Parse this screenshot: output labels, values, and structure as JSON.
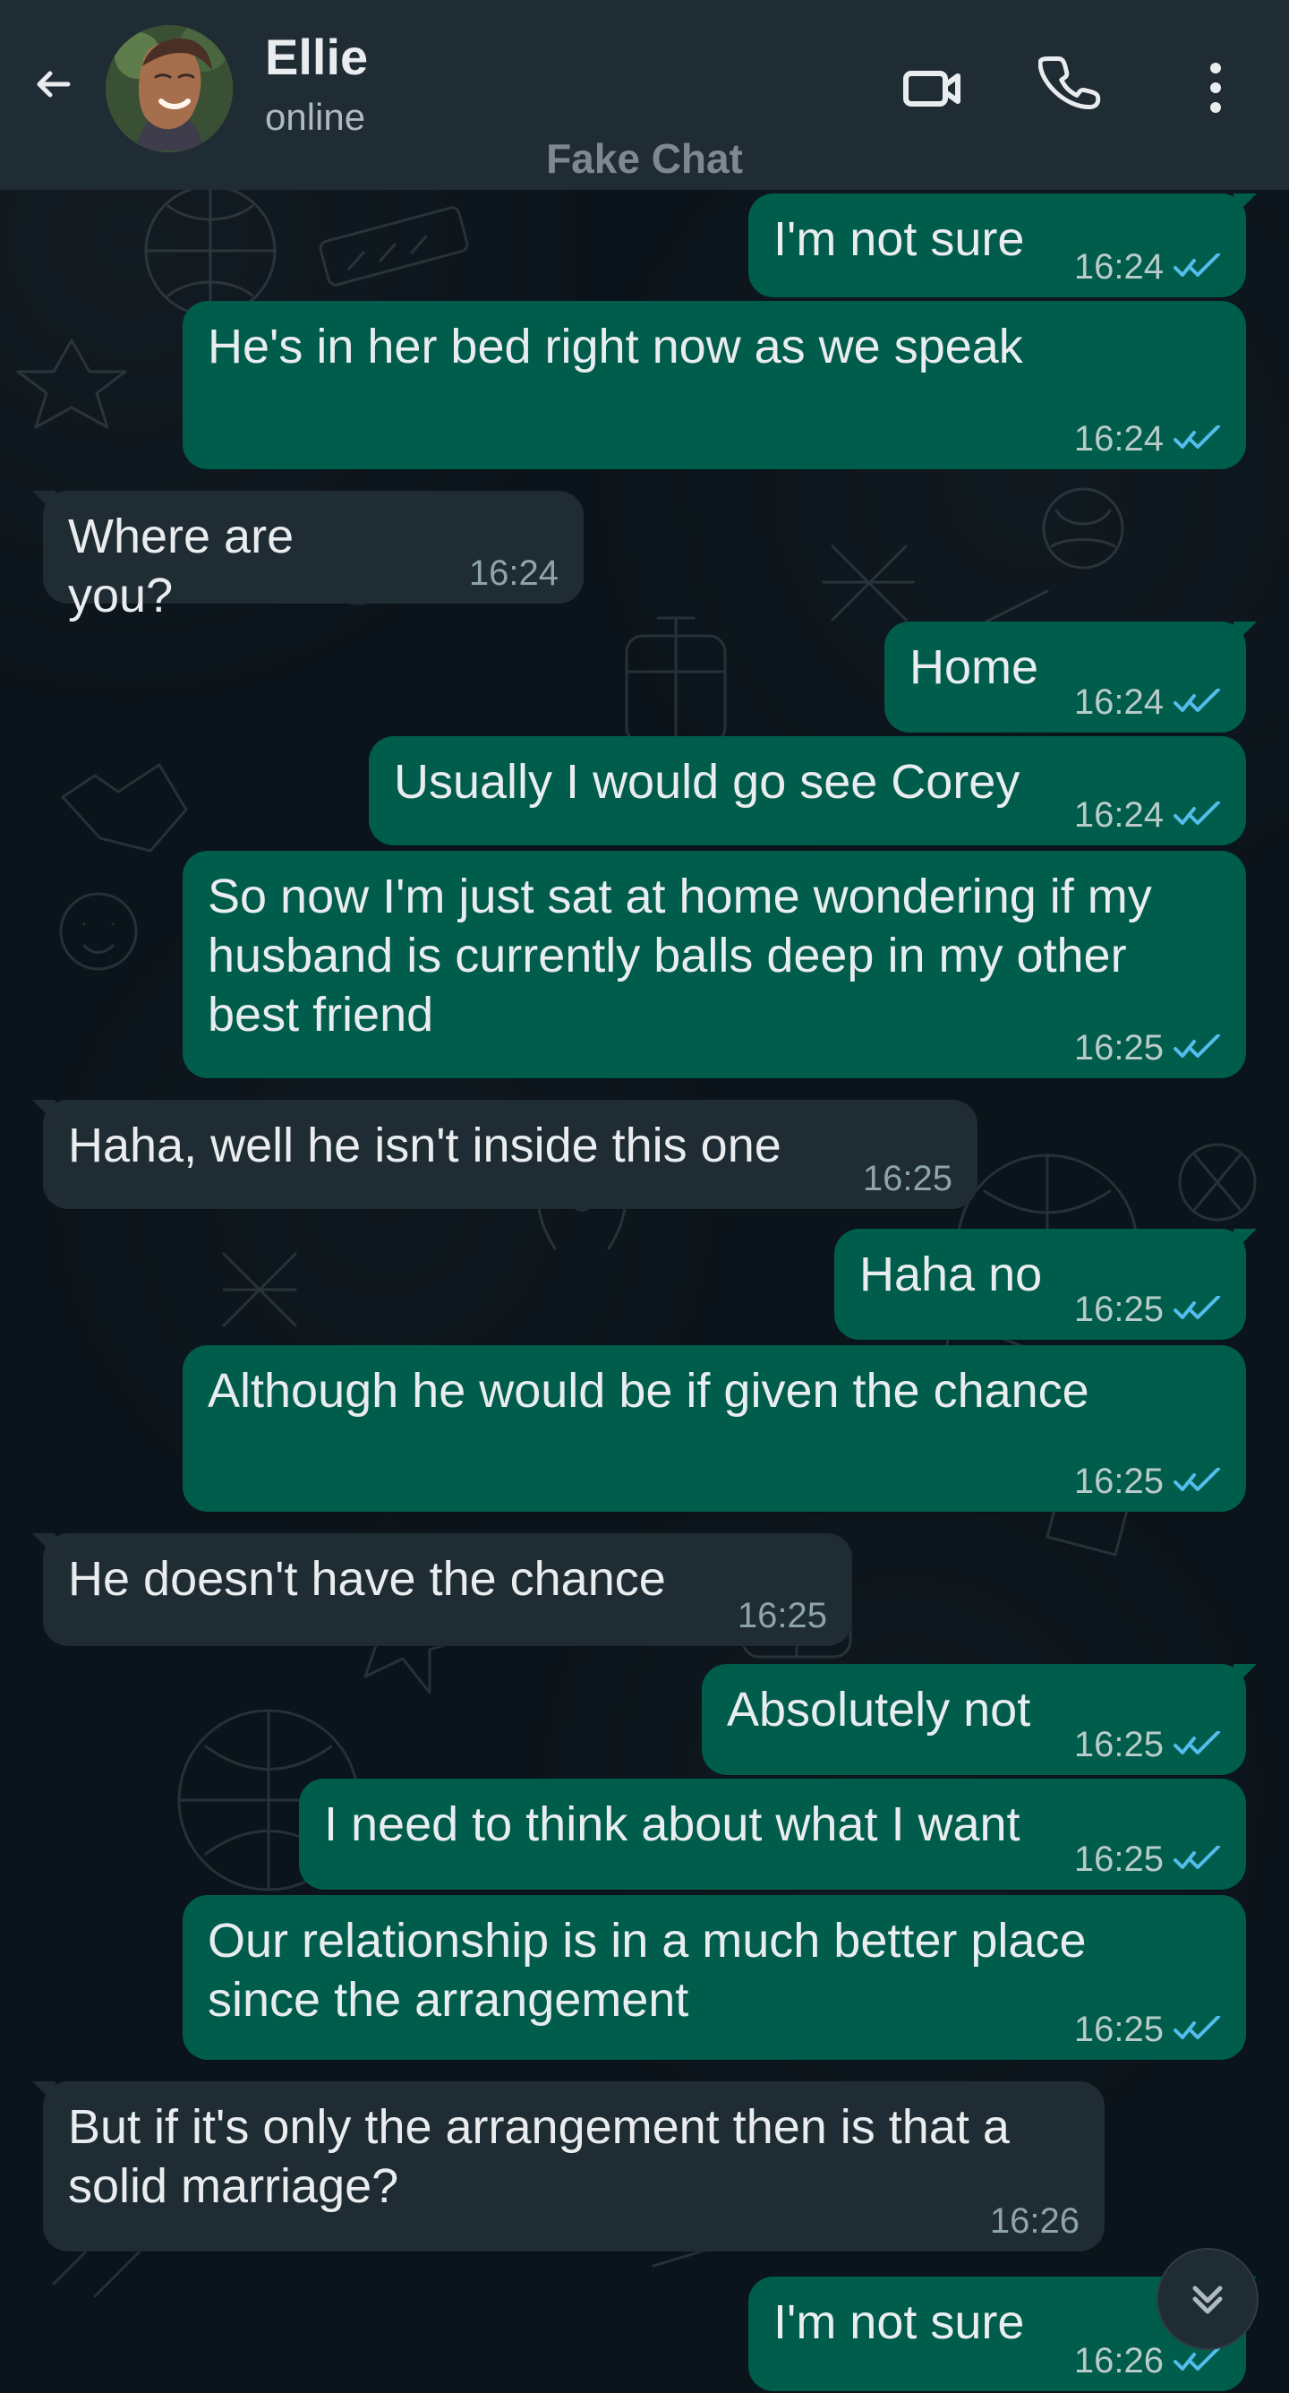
{
  "header": {
    "contact_name": "Ellie",
    "status": "online",
    "watermark": "Fake Chat"
  },
  "icons": {
    "back": "arrow-back-icon",
    "video": "video-call-icon",
    "phone": "phone-icon",
    "more": "more-icon",
    "scroll": "scroll-down-icon",
    "read": "double-check-icon"
  },
  "colors": {
    "header_bg": "#202c33",
    "chat_bg": "#0b141a",
    "outgoing_bg": "#005c4b",
    "incoming_bg": "#202c33",
    "read_tick": "#53bdeb"
  },
  "messages": [
    {
      "direction": "out",
      "text": "I'm not sure",
      "time": "16:24",
      "read": true
    },
    {
      "direction": "out",
      "text": "He's in her bed right now as we speak",
      "time": "16:24",
      "read": true
    },
    {
      "direction": "in",
      "text": "Where are you?",
      "time": "16:24"
    },
    {
      "direction": "out",
      "text": "Home",
      "time": "16:24",
      "read": true
    },
    {
      "direction": "out",
      "text": "Usually I would go see Corey",
      "time": "16:24",
      "read": true
    },
    {
      "direction": "out",
      "text": "So now I'm just sat at home wondering if my\nhusband is currently balls deep in my other\nbest friend",
      "time": "16:25",
      "read": true
    },
    {
      "direction": "in",
      "text": "Haha, well he isn't inside this one",
      "time": "16:25"
    },
    {
      "direction": "out",
      "text": "Haha no",
      "time": "16:25",
      "read": true
    },
    {
      "direction": "out",
      "text": "Although he would be if given the chance",
      "time": "16:25",
      "read": true
    },
    {
      "direction": "in",
      "text": "He doesn't have the chance",
      "time": "16:25"
    },
    {
      "direction": "out",
      "text": "Absolutely not",
      "time": "16:25",
      "read": true
    },
    {
      "direction": "out",
      "text": "I need to think about what I want",
      "time": "16:25",
      "read": true
    },
    {
      "direction": "out",
      "text": "Our relationship is in a much better place\nsince the arrangement",
      "time": "16:25",
      "read": true
    },
    {
      "direction": "in",
      "text": "But if it's only the arrangement then is that a\nsolid marriage?",
      "time": "16:26"
    },
    {
      "direction": "out",
      "text": "I'm not sure",
      "time": "16:26",
      "read": true
    }
  ]
}
